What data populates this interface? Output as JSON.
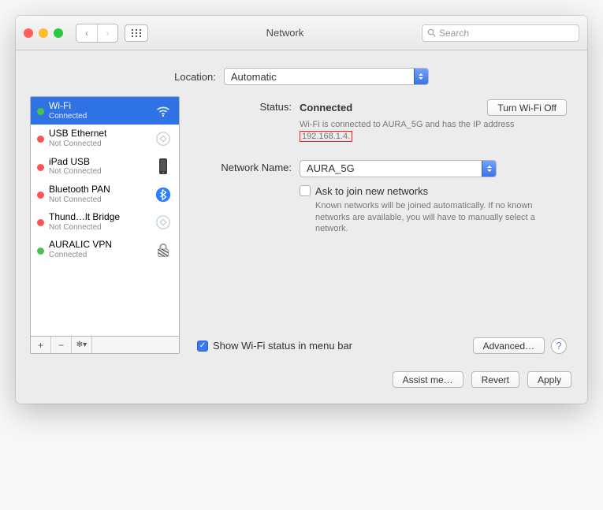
{
  "window_title": "Network",
  "search_placeholder": "Search",
  "location_label": "Location:",
  "location_value": "Automatic",
  "sidebar": {
    "items": [
      {
        "name": "Wi-Fi",
        "sub": "Connected",
        "status": "green",
        "icon": "wifi"
      },
      {
        "name": "USB Ethernet",
        "sub": "Not Connected",
        "status": "red",
        "icon": "eth"
      },
      {
        "name": "iPad USB",
        "sub": "Not Connected",
        "status": "red",
        "icon": "ipad"
      },
      {
        "name": "Bluetooth PAN",
        "sub": "Not Connected",
        "status": "red",
        "icon": "bt"
      },
      {
        "name": "Thund…lt Bridge",
        "sub": "Not Connected",
        "status": "red",
        "icon": "eth"
      },
      {
        "name": "AURALIC VPN",
        "sub": "Connected",
        "status": "green",
        "icon": "vpn"
      }
    ],
    "add": "+",
    "remove": "−",
    "gear": "✻▾"
  },
  "status_label": "Status:",
  "status_value": "Connected",
  "turn_off_label": "Turn Wi-Fi Off",
  "status_desc_1": "Wi-Fi is connected to AURA_5G and has the IP address ",
  "status_desc_highlight": "192.168.1.4.",
  "network_name_label": "Network Name:",
  "network_name_value": "AURA_5G",
  "ask_join_label": "Ask to join new networks",
  "ask_join_desc": "Known networks will be joined automatically. If no known networks are available, you will have to manually select a network.",
  "show_status_label": "Show Wi-Fi status in menu bar",
  "advanced_label": "Advanced…",
  "assist_label": "Assist me…",
  "revert_label": "Revert",
  "apply_label": "Apply"
}
